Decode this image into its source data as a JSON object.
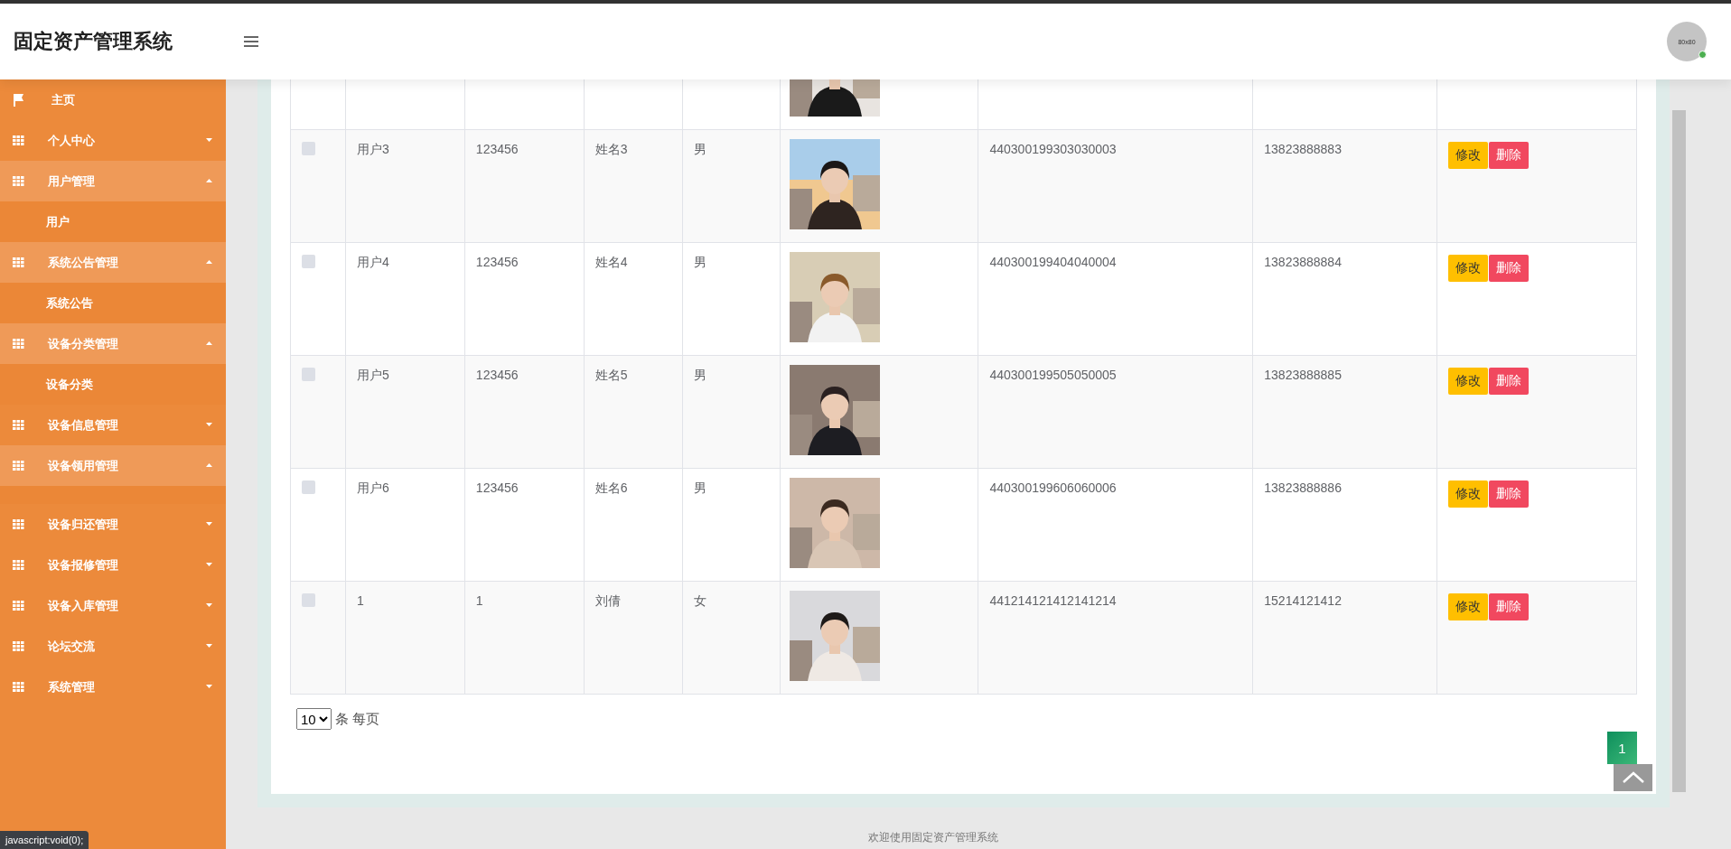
{
  "header": {
    "title": "固定资产管理系统",
    "avatar_text": "80x80",
    "online": true
  },
  "sidebar": {
    "items": [
      {
        "kind": "home",
        "label": "主页"
      },
      {
        "kind": "menu",
        "label": "个人中心",
        "expanded": false
      },
      {
        "kind": "menu",
        "label": "用户管理",
        "expanded": true,
        "children": [
          {
            "label": "用户"
          }
        ]
      },
      {
        "kind": "menu",
        "label": "系统公告管理",
        "expanded": true,
        "children": [
          {
            "label": "系统公告"
          }
        ]
      },
      {
        "kind": "menu",
        "label": "设备分类管理",
        "expanded": true,
        "children": [
          {
            "label": "设备分类"
          }
        ]
      },
      {
        "kind": "menu",
        "label": "设备信息管理",
        "expanded": false
      },
      {
        "kind": "menu",
        "label": "设备领用管理",
        "expanded": true
      },
      {
        "kind": "menu",
        "label": "设备归还管理",
        "expanded": false
      },
      {
        "kind": "menu",
        "label": "设备报修管理",
        "expanded": false
      },
      {
        "kind": "menu",
        "label": "设备入库管理",
        "expanded": false
      },
      {
        "kind": "menu",
        "label": "论坛交流",
        "expanded": false
      },
      {
        "kind": "menu",
        "label": "系统管理",
        "expanded": false
      }
    ]
  },
  "table": {
    "rows": [
      {
        "kind": "partial",
        "cells": [
          {
            "kind": "picture"
          }
        ]
      },
      {
        "kind": "record",
        "checked": false,
        "cells": [
          {
            "kind": "text",
            "text": "用户3"
          },
          {
            "kind": "text",
            "text": "123456"
          },
          {
            "kind": "text",
            "text": "姓名3"
          },
          {
            "kind": "text",
            "text": "男"
          },
          {
            "kind": "picture"
          },
          {
            "kind": "text",
            "text": "440300199303030003"
          },
          {
            "kind": "text",
            "text": "13823888883"
          }
        ],
        "actions": [
          {
            "kind": "edit",
            "label": "修改"
          },
          {
            "kind": "delete",
            "label": "删除"
          }
        ]
      },
      {
        "kind": "record",
        "checked": false,
        "cells": [
          {
            "kind": "text",
            "text": "用户4"
          },
          {
            "kind": "text",
            "text": "123456"
          },
          {
            "kind": "text",
            "text": "姓名4"
          },
          {
            "kind": "text",
            "text": "男"
          },
          {
            "kind": "picture"
          },
          {
            "kind": "text",
            "text": "440300199404040004"
          },
          {
            "kind": "text",
            "text": "13823888884"
          }
        ],
        "actions": [
          {
            "kind": "edit",
            "label": "修改"
          },
          {
            "kind": "delete",
            "label": "删除"
          }
        ]
      },
      {
        "kind": "record",
        "checked": false,
        "cells": [
          {
            "kind": "text",
            "text": "用户5"
          },
          {
            "kind": "text",
            "text": "123456"
          },
          {
            "kind": "text",
            "text": "姓名5"
          },
          {
            "kind": "text",
            "text": "男"
          },
          {
            "kind": "picture"
          },
          {
            "kind": "text",
            "text": "440300199505050005"
          },
          {
            "kind": "text",
            "text": "13823888885"
          }
        ],
        "actions": [
          {
            "kind": "edit",
            "label": "修改"
          },
          {
            "kind": "delete",
            "label": "删除"
          }
        ]
      },
      {
        "kind": "record",
        "checked": false,
        "cells": [
          {
            "kind": "text",
            "text": "用户6"
          },
          {
            "kind": "text",
            "text": "123456"
          },
          {
            "kind": "text",
            "text": "姓名6"
          },
          {
            "kind": "text",
            "text": "男"
          },
          {
            "kind": "picture"
          },
          {
            "kind": "text",
            "text": "440300199606060006"
          },
          {
            "kind": "text",
            "text": "13823888886"
          }
        ],
        "actions": [
          {
            "kind": "edit",
            "label": "修改"
          },
          {
            "kind": "delete",
            "label": "删除"
          }
        ]
      },
      {
        "kind": "record",
        "checked": false,
        "cells": [
          {
            "kind": "text",
            "text": "1"
          },
          {
            "kind": "text",
            "text": "1"
          },
          {
            "kind": "text",
            "text": "刘倩"
          },
          {
            "kind": "text",
            "text": "女"
          },
          {
            "kind": "picture"
          },
          {
            "kind": "text",
            "text": "441214121412141214"
          },
          {
            "kind": "text",
            "text": "15214121412"
          }
        ],
        "actions": [
          {
            "kind": "edit",
            "label": "修改"
          },
          {
            "kind": "delete",
            "label": "删除"
          }
        ]
      }
    ]
  },
  "pager": {
    "page_size": "10",
    "unit_label": "条 每页",
    "pages": [
      {
        "label": "1",
        "selected": true
      }
    ]
  },
  "footer": "欢迎使用固定资产管理系统",
  "status_tooltip": "javascript:void(0);"
}
